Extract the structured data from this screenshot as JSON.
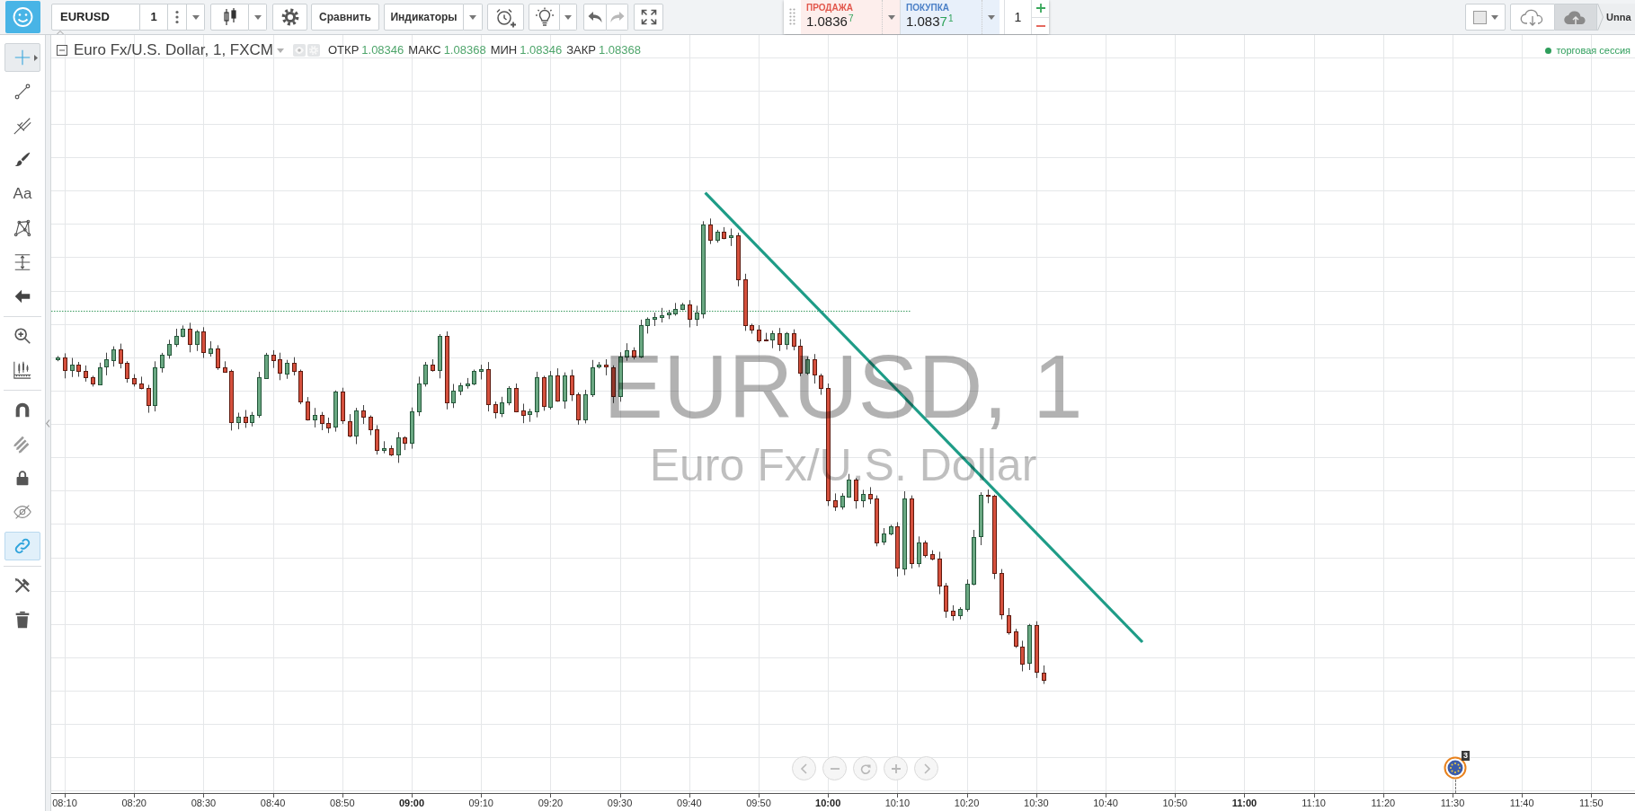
{
  "toolbar": {
    "symbol": "EURUSD",
    "interval": "1",
    "compare_button": "Сравнить",
    "indicators_button": "Индикаторы",
    "undo": {
      "disabled": false
    },
    "redo": {
      "disabled": true
    }
  },
  "order_panel": {
    "sell": {
      "label": "ПРОДАЖА",
      "price": [
        {
          "kind": "base",
          "text": "1.0836"
        },
        {
          "kind": "pip",
          "text": "7"
        }
      ]
    },
    "buy": {
      "label": "ПОКУПКА",
      "price": [
        {
          "kind": "base",
          "text": "1.083"
        },
        {
          "kind": "changed",
          "text": "7"
        },
        {
          "kind": "pip",
          "text": "1"
        }
      ]
    },
    "quantity": "1"
  },
  "layout_tab": {
    "label": "Unna"
  },
  "sidebar": {
    "groups": [
      {
        "tools": [
          {
            "kind": "crosshair",
            "selected": true
          },
          {
            "kind": "trendline",
            "selected": false
          },
          {
            "kind": "pitchfork",
            "selected": false
          },
          {
            "kind": "brush",
            "selected": false
          },
          {
            "kind": "text",
            "label": "Aa",
            "selected": false
          },
          {
            "kind": "pattern",
            "selected": false
          },
          {
            "kind": "projection",
            "selected": false
          },
          {
            "kind": "arrow",
            "selected": false
          }
        ]
      },
      {
        "tools": [
          {
            "kind": "zoom",
            "selected": false
          },
          {
            "kind": "measure",
            "selected": false
          }
        ]
      },
      {
        "tools": [
          {
            "kind": "magnet",
            "on": false
          },
          {
            "kind": "drawmode",
            "on": false
          },
          {
            "kind": "lock",
            "on": false
          },
          {
            "kind": "hide",
            "on": false
          },
          {
            "kind": "sync",
            "on": true
          }
        ]
      },
      {
        "tools": [
          {
            "kind": "remove"
          },
          {
            "kind": "trash"
          }
        ]
      }
    ]
  },
  "legend": {
    "title": "Euro Fx/U.S. Dollar, 1, FXCM",
    "values": [
      {
        "label": "ОТКР",
        "value": "1.08346"
      },
      {
        "label": "МАКС",
        "value": "1.08368"
      },
      {
        "label": "МИН",
        "value": "1.08346"
      },
      {
        "label": "ЗАКР",
        "value": "1.08368"
      }
    ]
  },
  "session": {
    "label": "торговая сессия"
  },
  "chart": {
    "watermark": {
      "symbol": "EURUSD, 1",
      "description": "Euro Fx/U.S. Dollar"
    },
    "event_marker": {
      "badge": "3"
    }
  },
  "time_axis": {
    "labels": [
      {
        "label": "08:10",
        "major": false
      },
      {
        "label": "08:20",
        "major": false
      },
      {
        "label": "08:30",
        "major": false
      },
      {
        "label": "08:40",
        "major": false
      },
      {
        "label": "08:50",
        "major": false
      },
      {
        "label": "09:00",
        "major": true
      },
      {
        "label": "09:10",
        "major": false
      },
      {
        "label": "09:20",
        "major": false
      },
      {
        "label": "09:30",
        "major": false
      },
      {
        "label": "09:40",
        "major": false
      },
      {
        "label": "09:50",
        "major": false
      },
      {
        "label": "10:00",
        "major": true
      },
      {
        "label": "10:10",
        "major": false
      },
      {
        "label": "10:20",
        "major": false
      },
      {
        "label": "10:30",
        "major": false
      },
      {
        "label": "10:40",
        "major": false
      },
      {
        "label": "10:50",
        "major": false
      },
      {
        "label": "11:00",
        "major": true
      },
      {
        "label": "11:10",
        "major": false
      },
      {
        "label": "11:20",
        "major": false
      },
      {
        "label": "11:30",
        "major": false
      },
      {
        "label": "11:40",
        "major": false
      },
      {
        "label": "11:50",
        "major": false
      }
    ]
  }
}
